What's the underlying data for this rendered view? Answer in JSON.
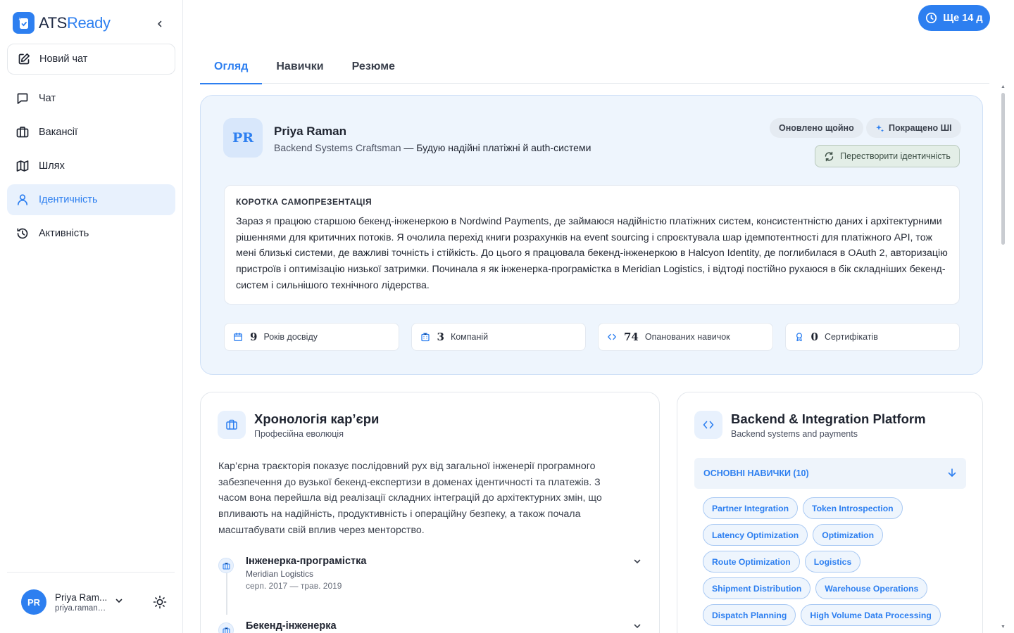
{
  "brand": {
    "name_part1": "ATS",
    "name_part2": "Ready"
  },
  "sidebar": {
    "new_chat": "Новий чат",
    "items": [
      {
        "label": "Чат",
        "icon": "chat-icon"
      },
      {
        "label": "Вакансії",
        "icon": "briefcase-icon"
      },
      {
        "label": "Шлях",
        "icon": "map-icon"
      },
      {
        "label": "Ідентичність",
        "icon": "user-icon",
        "active": true
      },
      {
        "label": "Активність",
        "icon": "history-icon"
      }
    ],
    "user": {
      "initials": "PR",
      "name": "Priya Ram...",
      "email": "priya.raman@..."
    }
  },
  "trial": {
    "label": "Ще 14 д"
  },
  "tabs": [
    "Огляд",
    "Навички",
    "Резюме"
  ],
  "profile": {
    "initials": "PR",
    "name": "Priya Raman",
    "headline_role": "Backend Systems Craftsman",
    "headline_sep": " — ",
    "headline_tail": "Будую надійні платіжні й auth-системи",
    "chip_updated": "Оновлено щойно",
    "chip_ai": "Покращено ШІ",
    "regen_label": "Перестворити ідентичність",
    "pitch_label": "КОРОТКА САМОПРЕЗЕНТАЦІЯ",
    "pitch_text": "Зараз я працюю старшою бекенд-інженеркою в Nordwind Payments, де займаюся надійністю платіжних систем, консистентністю даних і архітектурними рішеннями для критичних потоків. Я очолила перехід книги розрахунків на event sourcing і спроєктувала шар ідемпотентності для платіжного API, тож мені близькі системи, де важливі точність і стійкість. До цього я працювала бекенд-інженеркою в Halcyon Identity, де поглибилася в OAuth 2, авторизацію пристроїв і оптимізацію низької затримки. Починала я як інженерка-програмістка в Meridian Logistics, і відтоді постійно рухаюся в бік складніших бекенд-систем і сильнішого технічного лідерства.",
    "stats": [
      {
        "num": "9",
        "label": "Років досвіду",
        "icon": "calendar-icon"
      },
      {
        "num": "3",
        "label": "Компаній",
        "icon": "building-icon"
      },
      {
        "num": "74",
        "label": "Опанованих навичок",
        "icon": "code-icon"
      },
      {
        "num": "0",
        "label": "Сертифікатів",
        "icon": "award-icon"
      }
    ]
  },
  "career": {
    "title": "Хронологія кар’єри",
    "subtitle": "Професійна еволюція",
    "summary": "Кар’єрна траєкторія показує послідовний рух від загальної інженерії програмного забезпечення до вузької бекенд-експертизи в доменах ідентичності та платежів. З часом вона перейшла від реалізації складних інтеграцій до архітектурних змін, що впливають на надійність, продуктивність і операційну безпеку, а також почала масштабувати свій вплив через менторство.",
    "entries": [
      {
        "title": "Інженерка-програмістка",
        "company": "Meridian Logistics",
        "dates": "серп. 2017 — трав. 2019"
      },
      {
        "title": "Бекенд-інженерка"
      }
    ]
  },
  "platform": {
    "title": "Backend & Integration Platform",
    "subtitle": "Backend systems and payments",
    "skills_header": "ОСНОВНІ НАВИЧКИ (10)",
    "skills": [
      "Partner Integration",
      "Token Introspection",
      "Latency Optimization",
      "Optimization",
      "Route Optimization",
      "Logistics",
      "Shipment Distribution",
      "Warehouse Operations",
      "Dispatch Planning",
      "High Volume Data Processing"
    ]
  },
  "colors": {
    "accent": "#2d7ff0",
    "profile_bg": "#eef5fd",
    "active_nav_bg": "#e8f1fd"
  }
}
